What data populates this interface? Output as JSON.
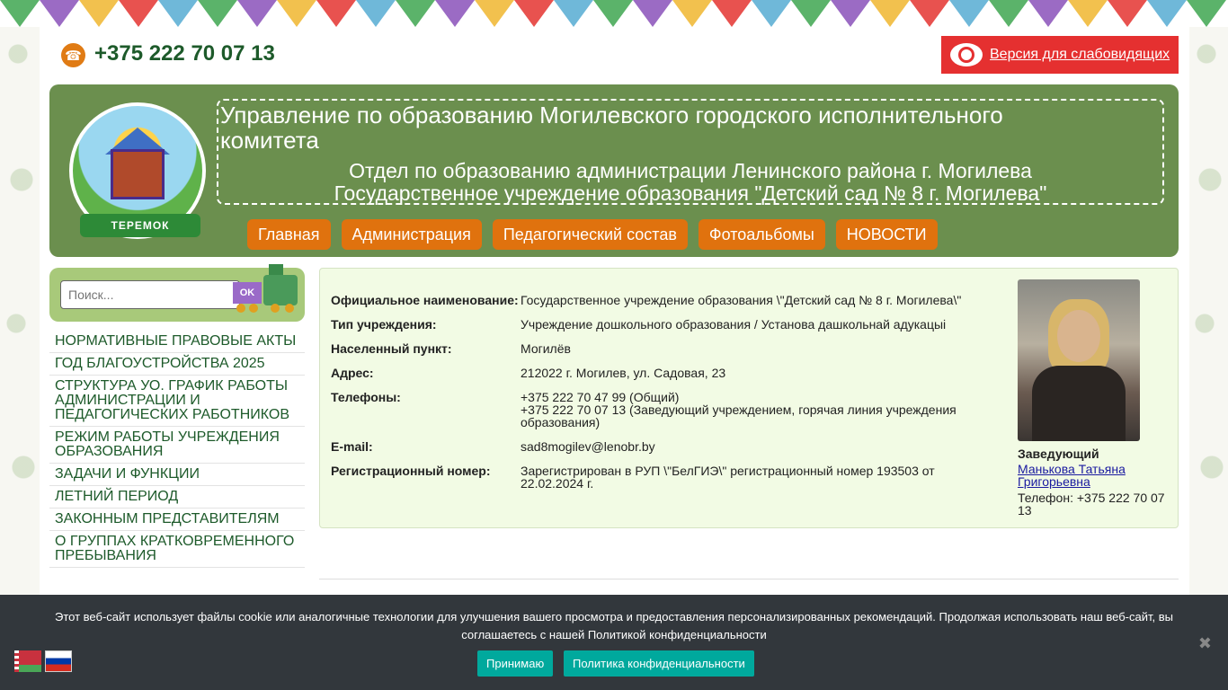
{
  "bunting_colors": [
    "#5bb36a",
    "#9b6bc4",
    "#f2c14e",
    "#e8524f",
    "#6fb8d9"
  ],
  "topbar": {
    "phone": "+375 222 70 07 13",
    "vision_label": "Версия для слабовидящих"
  },
  "header": {
    "title_main": "Управление по образованию Могилевского городского исполнительного комитета",
    "title_sub1": "Отдел по образованию администрации Ленинского района г. Могилева",
    "title_sub2": "Государственное учреждение образования \"Детский сад № 8 г. Могилева\"",
    "logo_text": "ТЕРЕМОК",
    "nav": [
      "Главная",
      "Администрация",
      "Педагогический состав",
      "Фотоальбомы",
      "НОВОСТИ"
    ]
  },
  "search": {
    "placeholder": "Поиск...",
    "ok_label": "OK"
  },
  "menu": [
    "НОРМАТИВНЫЕ ПРАВОВЫЕ АКТЫ",
    "ГОД БЛАГОУСТРОЙСТВА 2025",
    "СТРУКТУРА УО. ГРАФИК РАБОТЫ АДМИНИСТРАЦИИ И ПЕДАГОГИЧЕСКИХ РАБОТНИКОВ",
    "РЕЖИМ РАБОТЫ УЧРЕЖДЕНИЯ ОБРАЗОВАНИЯ",
    "ЗАДАЧИ И ФУНКЦИИ",
    "ЛЕТНИЙ ПЕРИОД",
    "ЗАКОННЫМ ПРЕДСТАВИТЕЛЯМ",
    "О ГРУППАХ КРАТКОВРЕМЕННОГО ПРЕБЫВАНИЯ"
  ],
  "info": {
    "rows": [
      {
        "key": "Официальное наименование:",
        "value": "Государственное учреждение образования \\\"Детский сад № 8 г. Могилева\\\""
      },
      {
        "key": "Тип учреждения:",
        "value": "Учреждение дошкольного образования / Установа дашкольнай адукацыі"
      },
      {
        "key": "Населенный пункт:",
        "value": "Могилёв"
      },
      {
        "key": "Адрес:",
        "value": "212022 г. Могилев, ул. Садовая, 23"
      },
      {
        "key": "Телефоны:",
        "value": "+375 222 70 47 99 (Общий)\n+375 222 70 07 13 (Заведующий учреждением, горячая линия учреждения образования)"
      },
      {
        "key": "E-mail:",
        "value": "sad8mogilev@lenobr.by"
      },
      {
        "key": "Регистрационный номер:",
        "value": "Зарегистрирован в РУП \\\"БелГИЭ\\\" регистрационный номер 193503 от 22.02.2024 г."
      }
    ],
    "head_title": "Заведующий",
    "head_name": "Манькова Татьяна Григорьевна",
    "head_phone": "Телефон: +375 222 70 07 13"
  },
  "cookie": {
    "text": "Этот веб-сайт использует файлы cookie или аналогичные технологии для улучшения вашего просмотра и предоставления персонализированных рекомендаций. Продолжая использовать наш веб-сайт, вы соглашаетесь с нашей Политикой конфиденциальности",
    "accept_label": "Принимаю",
    "policy_label": "Политика конфиденциальности",
    "close_glyph": "✖"
  }
}
